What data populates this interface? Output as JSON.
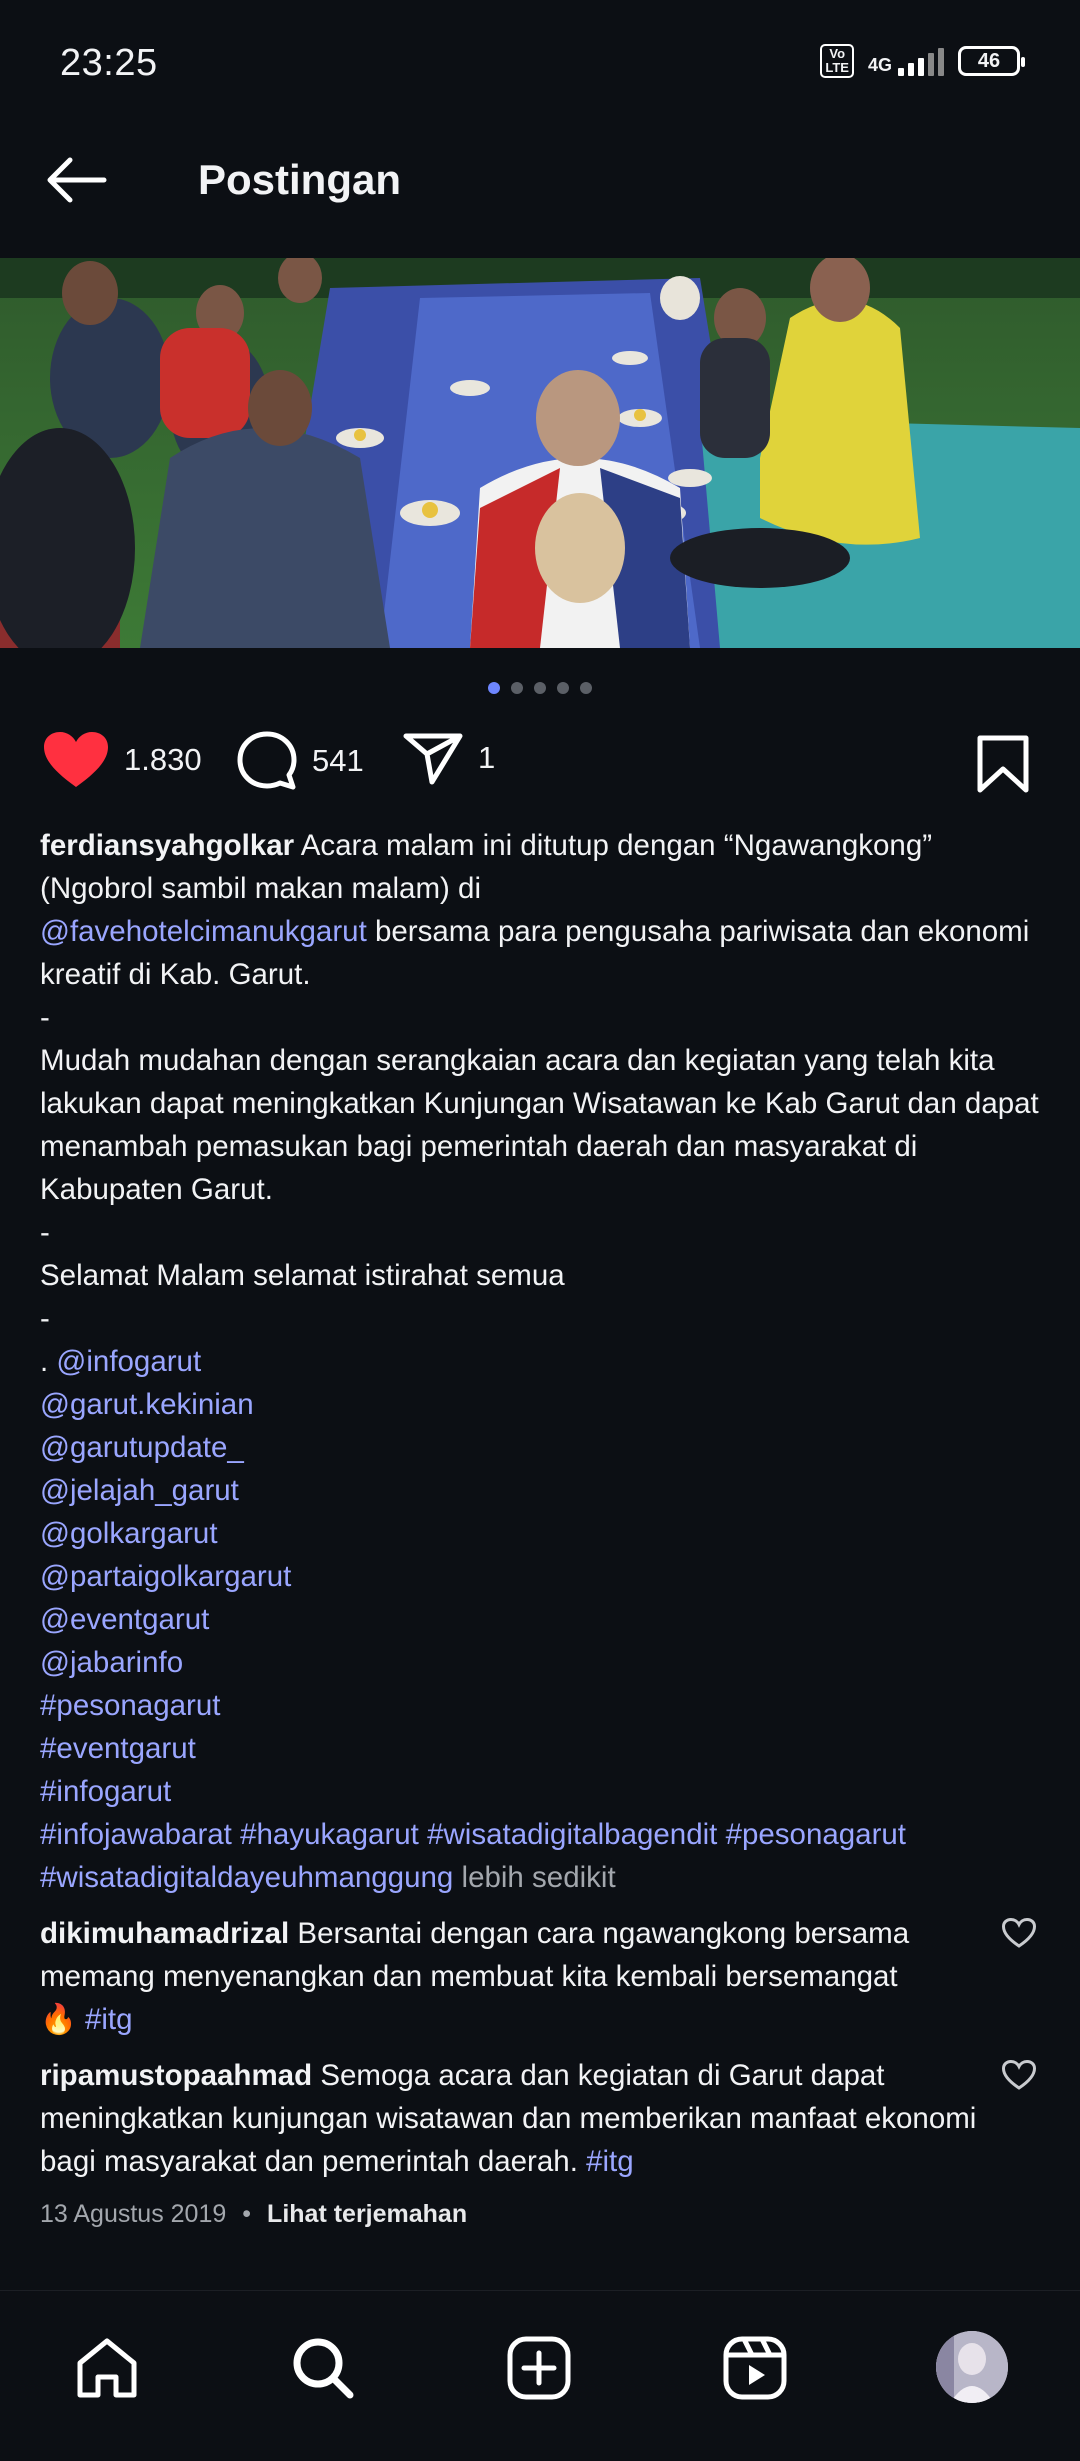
{
  "status_bar": {
    "time": "23:25",
    "volte": "Vo LTE",
    "network": "4G",
    "battery": "46"
  },
  "header": {
    "title": "Postingan",
    "back_icon": "arrow-left-icon"
  },
  "post": {
    "image_alt": "Group of men sitting on mats on the grass at night sharing a meal",
    "carousel": {
      "count": 5,
      "active": 1
    },
    "likes": "1.830",
    "comments": "541",
    "shares": "1",
    "caption": {
      "username": "ferdiansyahgolkar",
      "text_1": "Acara malam ini ditutup dengan “Ngawangkong” (Ngobrol sambil makan malam) di",
      "mention_1": "@favehotelcimanukgarut",
      "text_2": "bersama para pengusaha pariwisata dan ekonomi kreatif di Kab. Garut.",
      "sep_1": "-",
      "paragraph_2": "Mudah mudahan dengan serangkaian acara dan kegiatan yang telah kita lakukan dapat meningkatkan Kunjungan Wisatawan ke Kab Garut dan dapat menambah pemasukan bagi pemerintah daerah dan masyarakat di Kabupaten Garut.",
      "sep_2": "-",
      "paragraph_3": "Selamat Malam selamat istirahat semua",
      "sep_3": "-",
      "dot_prefix": ". ",
      "tags": [
        "@infogarut",
        "@garut.kekinian",
        "@garutupdate_",
        "@jelajah_garut",
        "@golkargarut",
        "@partaigolkargarut",
        "@eventgarut",
        "@jabarinfo",
        "#pesonagarut",
        "#eventgarut",
        "#infogarut"
      ],
      "tag_row_1": [
        "#infojawabarat",
        "#hayukagarut",
        "#wisatadigitalbagendit",
        "#pesonagarut"
      ],
      "tag_last": "#wisatadigitaldayeuhmanggung",
      "less": "lebih sedikit"
    },
    "comments_list": [
      {
        "username": "dikimuhamadrizal",
        "text": "Bersantai dengan cara ngawangkong bersama memang menyenangkan dan membuat kita kembali bersemangat",
        "emoji": "🔥",
        "tag": "#itg"
      },
      {
        "username": "ripamustopaahmad",
        "text": "Semoga acara dan kegiatan di Garut dapat meningkatkan kunjungan wisatawan dan memberikan manfaat ekonomi bagi masyarakat dan pemerintah daerah.",
        "tag": "#itg"
      }
    ],
    "date": "13 Agustus 2019",
    "bullet": "•",
    "translate": "Lihat terjemahan"
  },
  "bottom_nav": [
    {
      "name": "home-icon"
    },
    {
      "name": "search-icon"
    },
    {
      "name": "create-icon"
    },
    {
      "name": "reels-icon"
    },
    {
      "name": "profile-avatar"
    }
  ],
  "colors": {
    "background": "#0c0f14",
    "link": "#9aa6ff",
    "like": "#ff3040",
    "dot_active": "#6e86ff"
  }
}
